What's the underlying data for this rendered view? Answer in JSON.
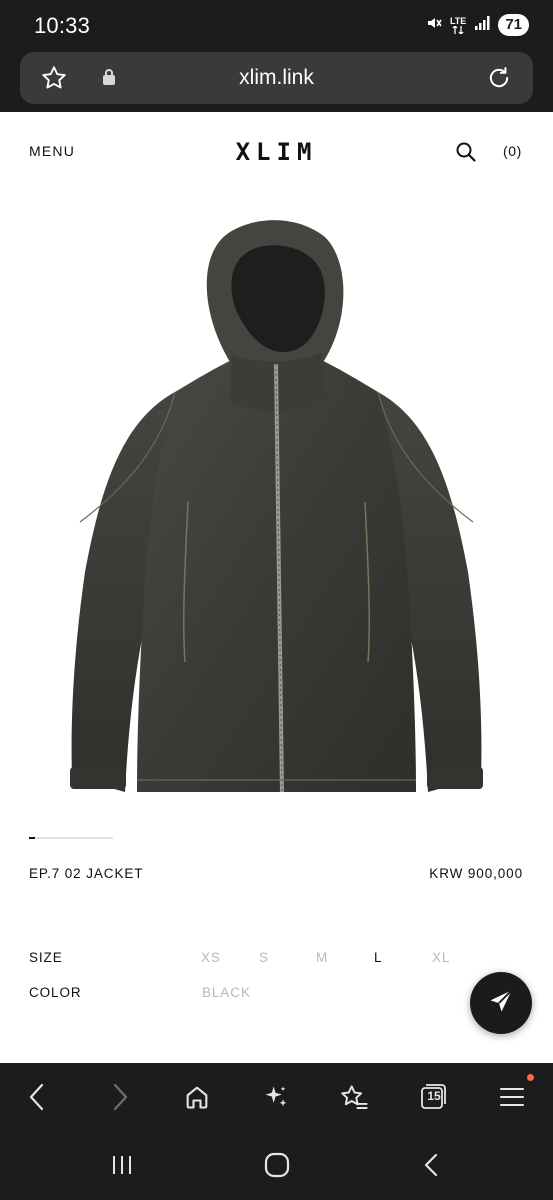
{
  "status_bar": {
    "time": "10:33",
    "network": "LTE",
    "battery": "71",
    "icons": [
      "mute-icon",
      "lte-icon",
      "signal-icon",
      "battery-icon"
    ]
  },
  "browser": {
    "url": "xlim.link",
    "icons": [
      "favorite-star-icon",
      "lock-icon",
      "reload-icon"
    ]
  },
  "site_header": {
    "menu_label": "MENU",
    "logo": "XLIM",
    "cart_label": "(0)",
    "icons": [
      "search-icon"
    ]
  },
  "product": {
    "name": "EP.7 02 JACKET",
    "price": "KRW 900,000",
    "image_alt": "Black washed denim hooded zip jacket",
    "carousel_progress": 0.07
  },
  "options": {
    "size_label": "SIZE",
    "sizes": [
      "XS",
      "S",
      "M",
      "L",
      "XL"
    ],
    "selected_size": "L",
    "color_label": "COLOR",
    "color_value": "BLACK"
  },
  "toolbar": {
    "icons": [
      "back-icon",
      "forward-icon",
      "home-icon",
      "ai-sparkle-icon",
      "bookmarks-icon",
      "tabs-icon",
      "menu-icon"
    ],
    "tab_count": "15"
  },
  "system_nav": {
    "icons": [
      "recent-apps-icon",
      "home-button-icon",
      "back-nav-icon"
    ]
  },
  "colors": {
    "chrome_bg": "#1c1c1e",
    "url_bar_bg": "#3a3a3c",
    "text_primary": "#111111",
    "text_muted": "#b9b9b9",
    "notification_dot": "#ff6a3d"
  }
}
